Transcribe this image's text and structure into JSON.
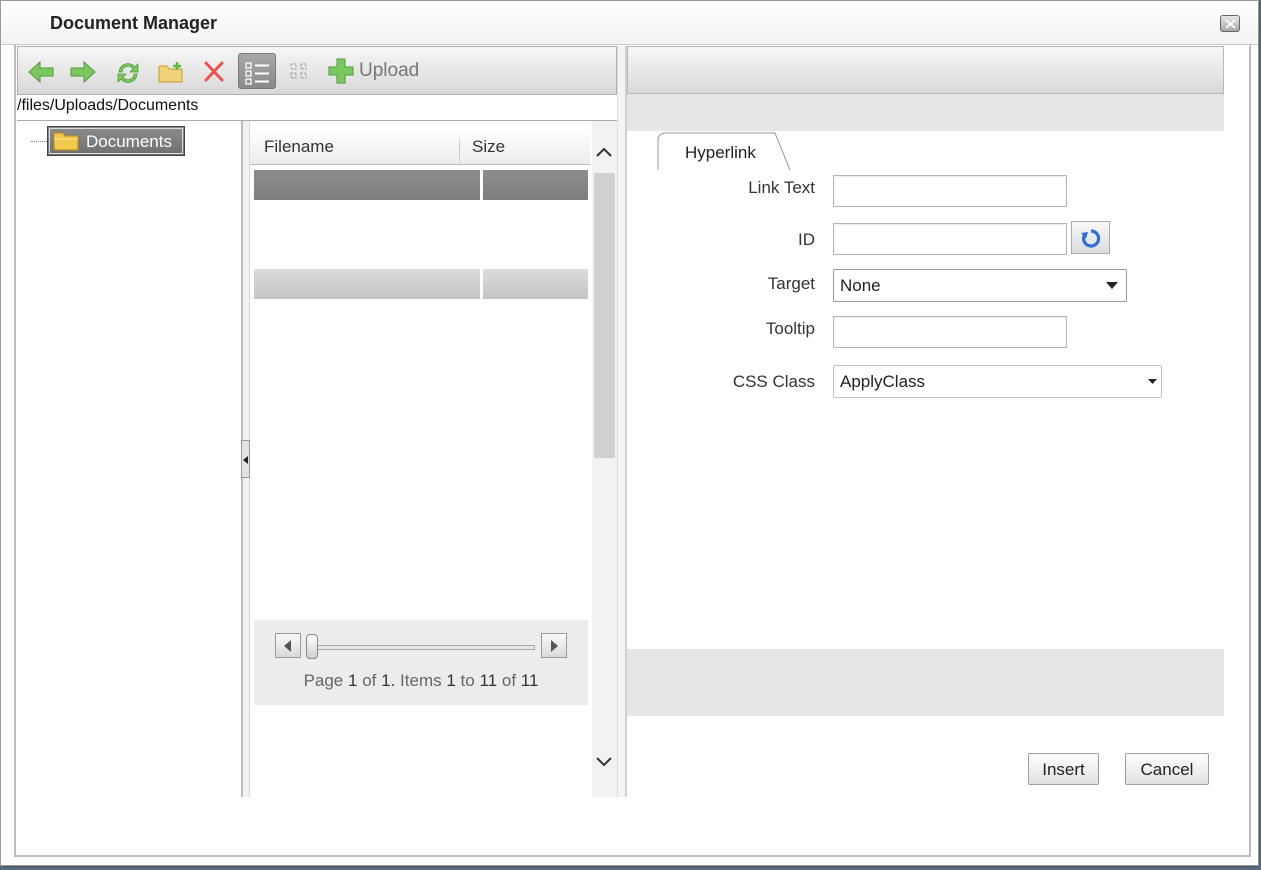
{
  "window": {
    "title": "Document Manager"
  },
  "toolbar": {
    "buttons": [
      "back-icon",
      "forward-icon",
      "refresh-icon",
      "new-folder-icon",
      "delete-icon",
      "list-view-icon",
      "thumbnail-view-icon"
    ],
    "upload_label": "Upload"
  },
  "path": "/files/Uploads/Documents",
  "tree": {
    "root_label": "Documents"
  },
  "grid": {
    "columns": [
      "Filename",
      "Size"
    ],
    "pager": {
      "prefix": "Page",
      "page": "1",
      "of_label": "of",
      "pages": "1.",
      "items_label": "Items",
      "from": "1",
      "to_label": "to",
      "to": "11",
      "of2_label": "of",
      "total": "11"
    }
  },
  "properties": {
    "tab_label": "Hyperlink",
    "fields": {
      "link_text_label": "Link Text",
      "link_text_value": "",
      "id_label": "ID",
      "id_value": "",
      "target_label": "Target",
      "target_value": "None",
      "tooltip_label": "Tooltip",
      "tooltip_value": "",
      "css_class_label": "CSS Class",
      "css_class_value": "ApplyClass"
    }
  },
  "actions": {
    "insert_label": "Insert",
    "cancel_label": "Cancel"
  },
  "colors": {
    "toolbar_green": "#5fba3c",
    "delete_red": "#e04040",
    "folder_yellow": "#e8c24a",
    "reset_blue": "#2f6fd6"
  }
}
